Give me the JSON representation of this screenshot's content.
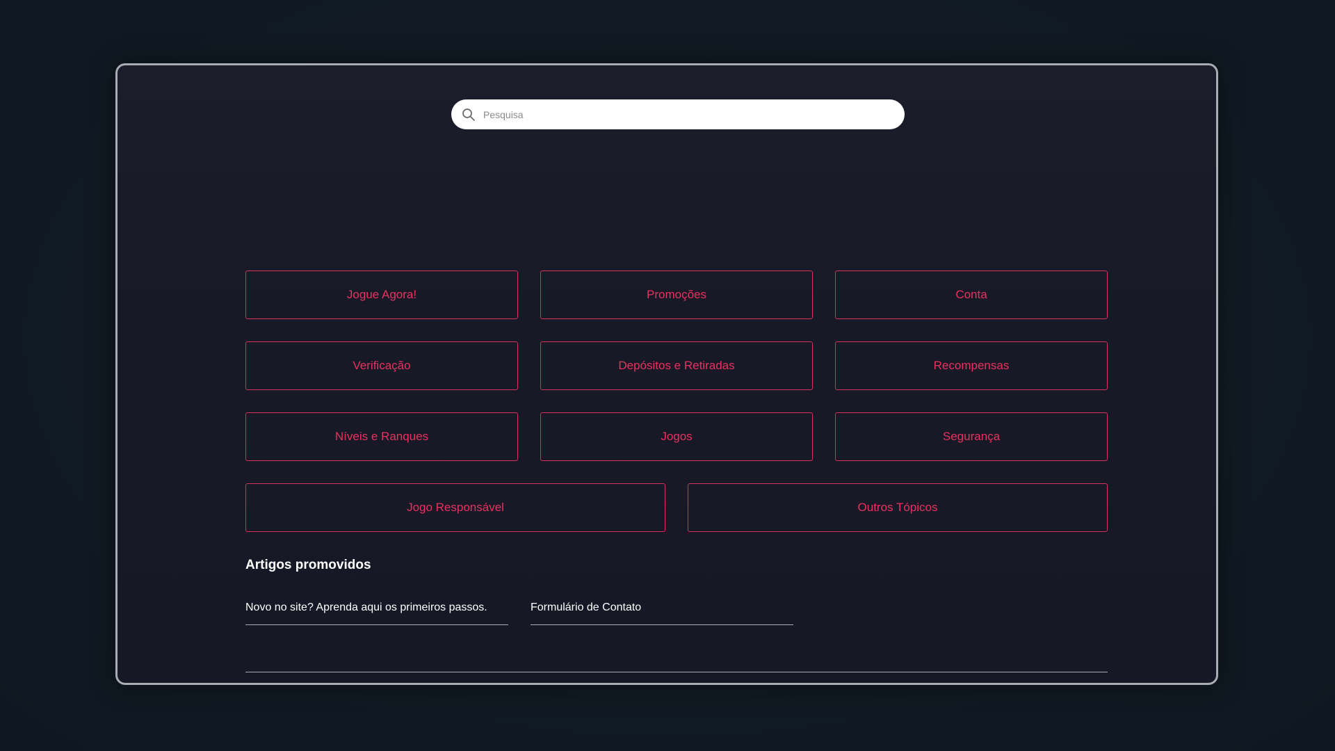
{
  "search": {
    "placeholder": "Pesquisa",
    "icon": "search-icon"
  },
  "categories": {
    "row1": [
      "Jogue Agora!",
      "Promoções",
      "Conta"
    ],
    "row2": [
      "Verificação",
      "Depósitos e Retiradas",
      "Recompensas"
    ],
    "row3": [
      "Níveis e Ranques",
      "Jogos",
      "Segurança"
    ],
    "row4": [
      "Jogo Responsável",
      "Outros Tópicos"
    ]
  },
  "promoted": {
    "title": "Artigos promovidos",
    "articles": [
      "Novo no site? Aprenda aqui os primeiros passos.",
      "Formulário de Contato"
    ]
  },
  "colors": {
    "background": "#111a23",
    "panel": "#1a1b28",
    "accent": "#e8325f",
    "frame_border": "#a9acb3"
  }
}
